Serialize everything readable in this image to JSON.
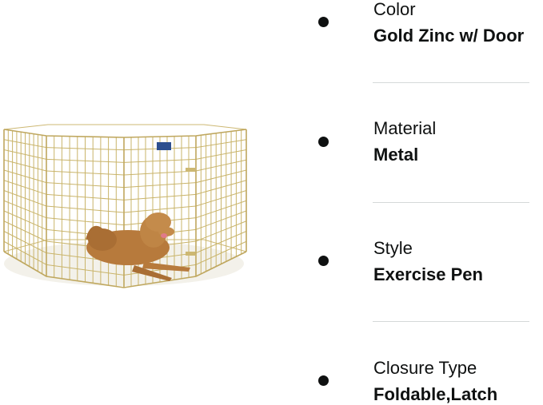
{
  "product": {
    "image_alt": "Gold zinc octagonal exercise pen with a golden retriever mix lying inside",
    "pen_color": "#c9b46a",
    "dog_color": "#b77a3c"
  },
  "specs": [
    {
      "label": "Color",
      "value": "Gold Zinc w/ Door"
    },
    {
      "label": "Material",
      "value": "Metal"
    },
    {
      "label": "Style",
      "value": "Exercise Pen"
    },
    {
      "label": "Closure Type",
      "value": "Foldable,Latch"
    }
  ]
}
